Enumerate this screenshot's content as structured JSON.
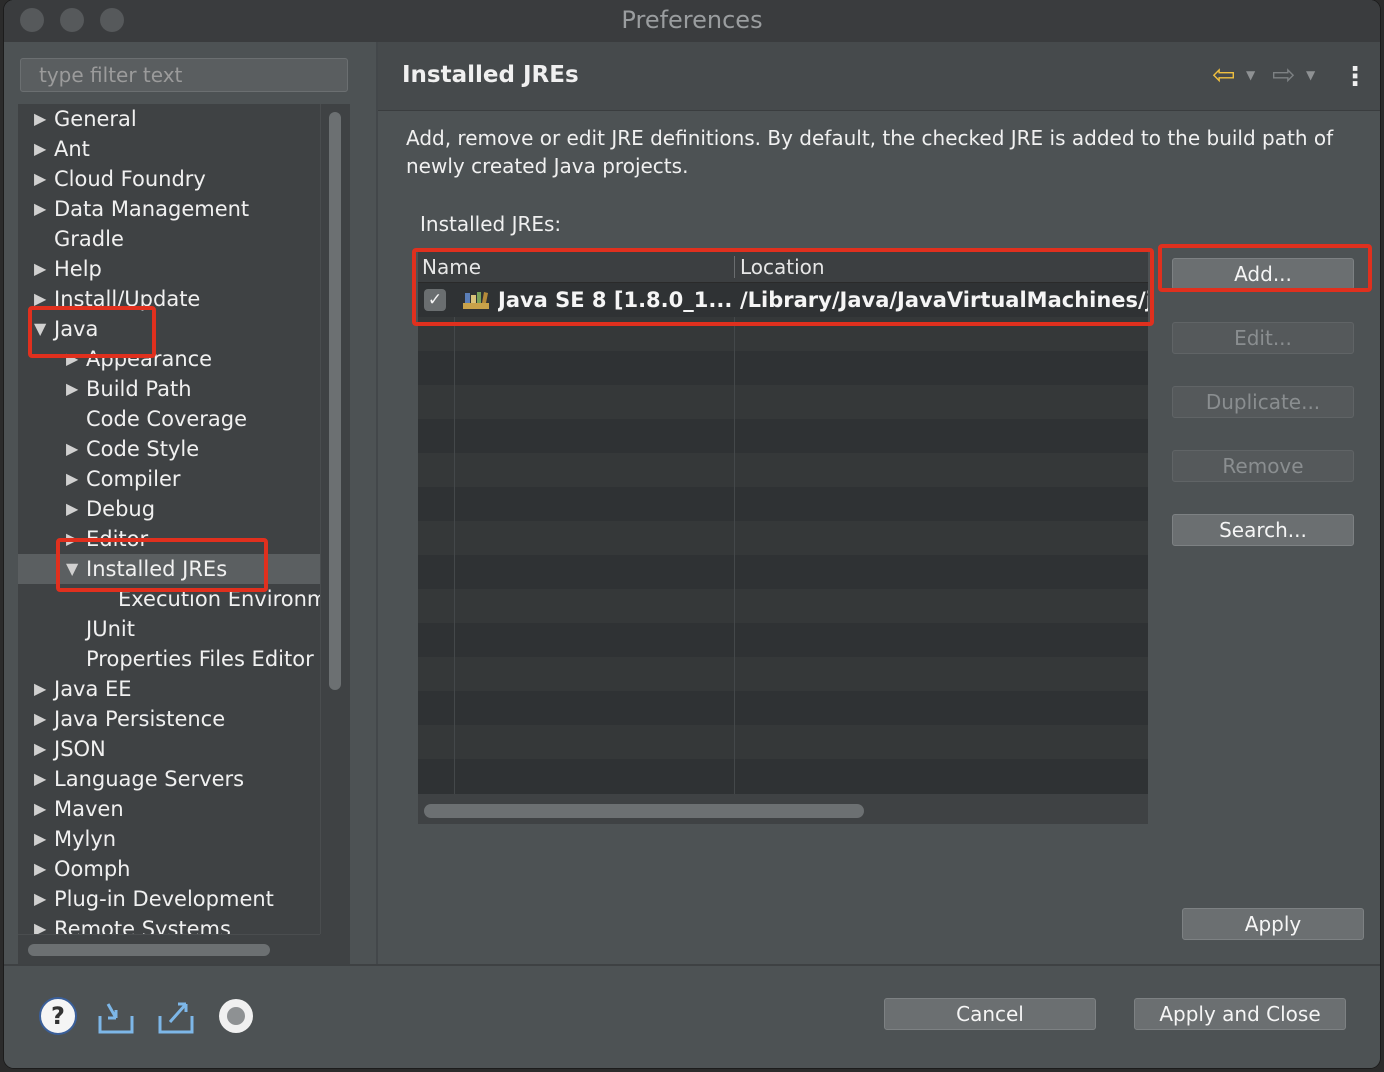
{
  "window": {
    "title": "Preferences"
  },
  "filter": {
    "placeholder": "type filter text"
  },
  "tree": {
    "general": "General",
    "ant": "Ant",
    "cloud_foundry": "Cloud Foundry",
    "data_management": "Data Management",
    "gradle": "Gradle",
    "help": "Help",
    "install_update": "Install/Update",
    "java": "Java",
    "appearance": "Appearance",
    "build_path": "Build Path",
    "code_coverage": "Code Coverage",
    "code_style": "Code Style",
    "compiler": "Compiler",
    "debug": "Debug",
    "editor": "Editor",
    "installed_jres": "Installed JREs",
    "execution_environments": "Execution Environm",
    "junit": "JUnit",
    "properties_files_editor": "Properties Files Editor",
    "java_ee": "Java EE",
    "java_persistence": "Java Persistence",
    "json": "JSON",
    "language_servers": "Language Servers",
    "maven": "Maven",
    "mylyn": "Mylyn",
    "oomph": "Oomph",
    "plugin_development": "Plug-in Development",
    "remote_systems": "Remote Systems"
  },
  "page": {
    "title": "Installed JREs",
    "description": "Add, remove or edit JRE definitions. By default, the checked JRE is added to the build path of newly created Java projects.",
    "installed_label": "Installed JREs:"
  },
  "table": {
    "columns": {
      "name": "Name",
      "location": "Location"
    },
    "rows": [
      {
        "checked": true,
        "name": "Java SE 8 [1.8.0_1...",
        "location": "/Library/Java/JavaVirtualMachines/jd"
      }
    ]
  },
  "buttons": {
    "add": "Add...",
    "edit": "Edit...",
    "duplicate": "Duplicate...",
    "remove": "Remove",
    "search": "Search...",
    "apply": "Apply",
    "cancel": "Cancel",
    "apply_and_close": "Apply and Close"
  },
  "icons": {
    "back": "back-arrow-icon",
    "forward": "forward-arrow-icon",
    "menu": "kebab-menu-icon",
    "help": "help-icon",
    "import": "import-icon",
    "export": "export-icon",
    "record": "record-icon"
  },
  "colors": {
    "annotation_red": "#e0301e",
    "back_arrow": "#f0c040"
  }
}
